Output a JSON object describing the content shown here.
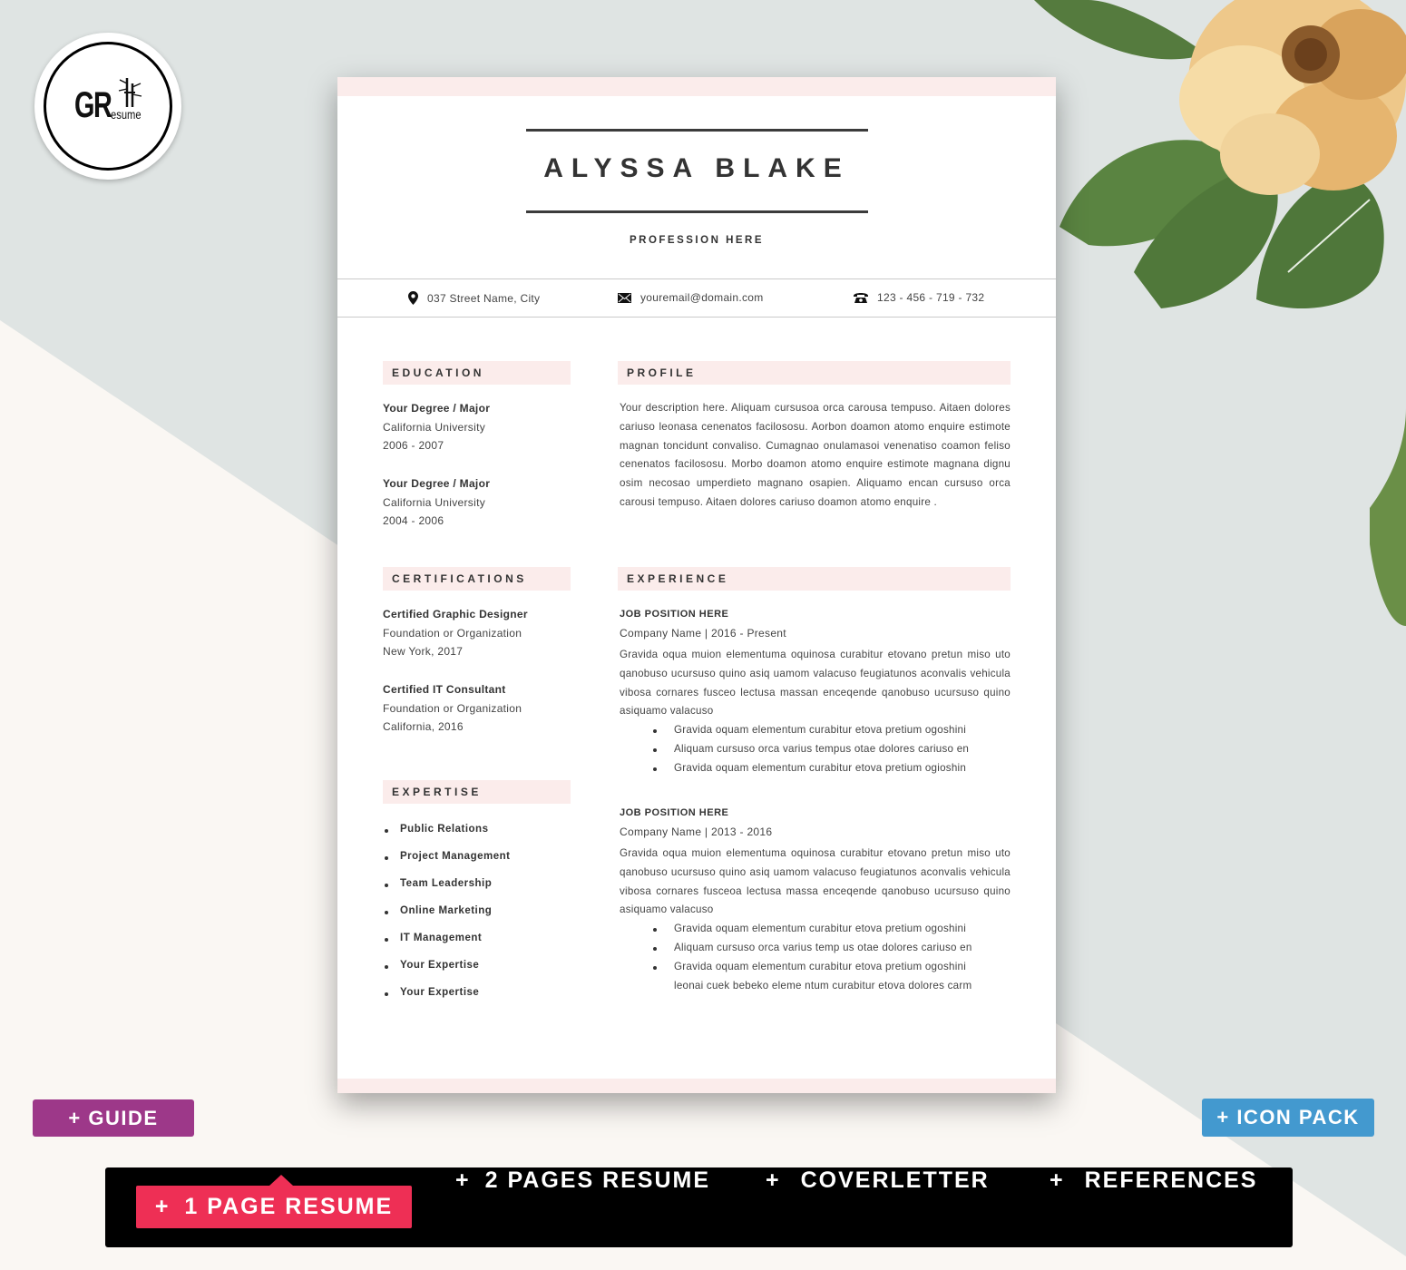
{
  "brand": {
    "logo_main": "GR",
    "logo_sub": "esume"
  },
  "resume": {
    "name": "ALYSSA BLAKE",
    "profession": "PROFESSION HERE",
    "contact": {
      "address": "037  Street Name, City",
      "email": "youremail@domain.com",
      "phone": "123 - 456 - 719 - 732"
    },
    "education": {
      "heading": "EDUCATION",
      "entries": [
        {
          "degree": "Your Degree / Major",
          "school": "California University",
          "years": "2006 - 2007"
        },
        {
          "degree": "Your Degree / Major",
          "school": "California University",
          "years": "2004 - 2006"
        }
      ]
    },
    "certifications": {
      "heading": "CERTIFICATIONS",
      "entries": [
        {
          "title": "Certified  Graphic Designer",
          "org": "Foundation or Organization",
          "place": "New York, 2017"
        },
        {
          "title": "Certified  IT Consultant",
          "org": "Foundation or Organization",
          "place": "California, 2016"
        }
      ]
    },
    "expertise": {
      "heading": "EXPERTISE",
      "items": [
        "Public Relations",
        "Project Management",
        "Team Leadership",
        "Online Marketing",
        "IT Management",
        "Your Expertise",
        "Your Expertise"
      ]
    },
    "profile": {
      "heading": "PROFILE",
      "text": "Your description here. Aliquam cursusoa orca carousa tempuso. Aitaen dolores cariuso leonasa cenenatos facilososu. Aorbon doamon atomo enquire estimote  magnan toncidunt convaliso. Cumagnao onulamasoi venenatiso coamon feliso cenenatos facilososu. Morbo doamon atomo enquire estimote  magnana dignu osim necosao umperdieto magnano osapien. Aliquamo encan cursuso orca carousi tempuso. Aitaen dolores cariuso doamon atomo enquire ."
    },
    "experience": {
      "heading": "EXPERIENCE",
      "jobs": [
        {
          "title": "JOB POSITION HERE",
          "company": "Company Name | 2016 - Present",
          "description": "Gravida oqua muion elementuma oquinosa curabitur etovano pretun miso uto qanobuso ucursuso quino asiq uamom valacuso feugiatunos aconvalis vehicula vibosa cornares fusceo lectusa massan enceqende qanobuso ucursuso quino asiquamo valacuso",
          "bullets": [
            "Gravida oquam elementum curabitur etova pretium ogoshini",
            "Aliquam cursuso orca varius tempus otae dolores cariuso en",
            "Gravida oquam elementum curabitur etova pretium ogioshin"
          ]
        },
        {
          "title": "JOB POSITION HERE",
          "company": "Company Name | 2013 - 2016",
          "description": "Gravida oqua muion elementuma oquinosa curabitur etovano pretun miso uto qanobuso ucursuso quino asiq uamom valacuso feugiatunos aconvalis vehicula vibosa cornares fusceoa lectusa massa enceqende qanobuso ucursuso quino asiquamo valacuso",
          "bullets": [
            "Gravida oquam elementum curabitur etova pretium ogoshini",
            "Aliquam cursuso orca varius temp us otae dolores cariuso en",
            "Gravida oquam elementum curabitur etova pretium ogoshini",
            "leonai cuek bebeko eleme ntum curabitur etova dolores carm"
          ]
        }
      ]
    }
  },
  "badges": {
    "guide": "+ GUIDE",
    "icon_pack": "+ ICON PACK"
  },
  "bottom_tabs": [
    {
      "label": "1 PAGE RESUME",
      "active": true
    },
    {
      "label": "2 PAGES RESUME",
      "active": false
    },
    {
      "label": "COVERLETTER",
      "active": false
    },
    {
      "label": "REFERENCES",
      "active": false
    }
  ],
  "tab_plus": "+",
  "colors": {
    "accent_pink": "#ee2f55",
    "guide_purple": "#9d3889",
    "icon_pack_blue": "#4399cf",
    "section_tint": "#fbeceb",
    "bg_gray": "#dfe4e3",
    "bg_cream": "#faf7f3"
  }
}
